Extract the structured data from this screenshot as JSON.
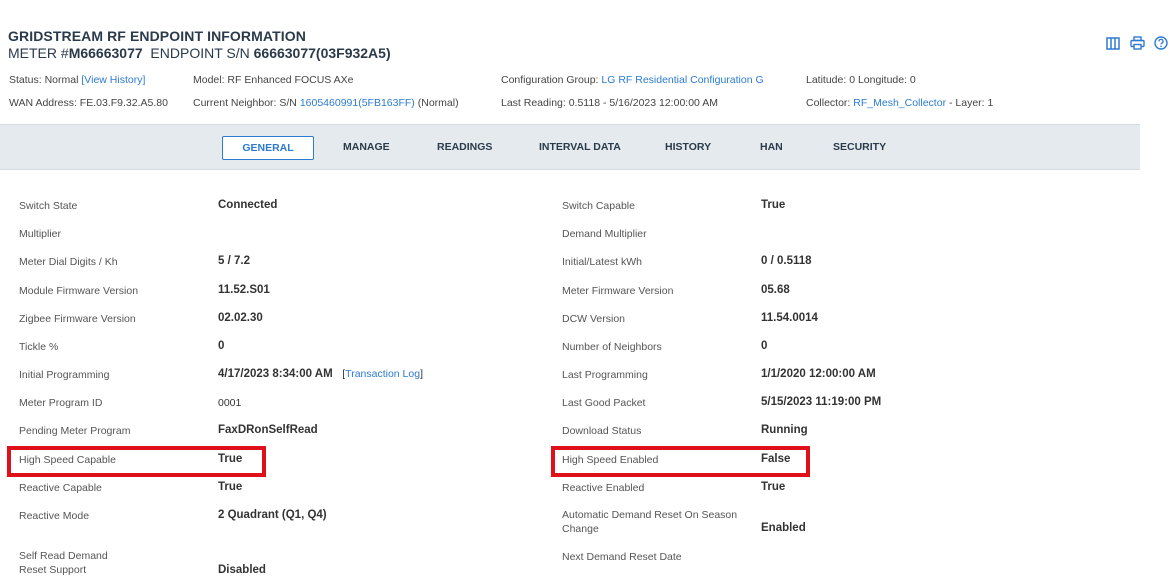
{
  "header": {
    "title": "GRIDSTREAM RF ENDPOINT INFORMATION",
    "meter_prefix": "METER #",
    "meter_number": "M66663077",
    "endpoint_prefix": "ENDPOINT S/N",
    "endpoint_sn": "66663077(03F932A5)"
  },
  "icons": [
    "columns-icon",
    "print-icon",
    "help-icon"
  ],
  "info": {
    "status_label": "Status: Normal",
    "status_link": "[View History]",
    "wan": "WAN Address: FE.03.F9.32.A5.80",
    "model": "Model: RF Enhanced FOCUS AXe",
    "neighbor_prefix": "Current Neighbor: S/N",
    "neighbor_link": "1605460991(5FB163FF)",
    "neighbor_suffix": "(Normal)",
    "config_prefix": "Configuration Group:",
    "config_link": "LG RF Residential Configuration G",
    "last_reading": "Last Reading: 0.5118 - 5/16/2023 12:00:00 AM",
    "latlong": "Latitude: 0  Longitude: 0",
    "collector_prefix": "Collector:",
    "collector_link": "RF_Mesh_Collector",
    "collector_suffix": "- Layer: 1"
  },
  "tabs": [
    "GENERAL",
    "MANAGE",
    "READINGS",
    "INTERVAL DATA",
    "HISTORY",
    "HAN",
    "SECURITY"
  ],
  "left": [
    {
      "label": "Switch State",
      "value": "Connected"
    },
    {
      "label": "Multiplier",
      "value": ""
    },
    {
      "label": "Meter Dial Digits / Kh",
      "value": "5 / 7.2"
    },
    {
      "label": "Module Firmware Version",
      "value": "11.52.S01"
    },
    {
      "label": "Zigbee Firmware Version",
      "value": "02.02.30"
    },
    {
      "label": "Tickle %",
      "value": "0"
    },
    {
      "label": "Initial Programming",
      "value": "4/17/2023 8:34:00 AM",
      "extra_open": "[",
      "extra_link": "Transaction Log",
      "extra_close": "]"
    },
    {
      "label": "Meter Program ID",
      "value": "0001"
    },
    {
      "label": "Pending Meter Program",
      "value": "FaxDRonSelfRead"
    },
    {
      "label": "High Speed Capable",
      "value": "True"
    },
    {
      "label": "Reactive Capable",
      "value": "True"
    },
    {
      "label": "Reactive Mode",
      "value": "2 Quadrant (Q1, Q4)"
    },
    {
      "label_line1": "Self Read Demand",
      "label_line2": "Reset Support",
      "value": "Disabled"
    }
  ],
  "right": [
    {
      "label": "Switch Capable",
      "value": "True"
    },
    {
      "label": "Demand Multiplier",
      "value": ""
    },
    {
      "label": "Initial/Latest kWh",
      "value": "0 / 0.5118"
    },
    {
      "label": "Meter Firmware Version",
      "value": "05.68"
    },
    {
      "label": "DCW Version",
      "value": "11.54.0014"
    },
    {
      "label": "Number of Neighbors",
      "value": "0"
    },
    {
      "label": "Last Programming",
      "value": "1/1/2020 12:00:00 AM"
    },
    {
      "label": "Last Good Packet",
      "value": "5/15/2023 11:19:00 PM"
    },
    {
      "label": "Download Status",
      "value": "Running"
    },
    {
      "label": "High Speed Enabled",
      "value": "False"
    },
    {
      "label": "Reactive Enabled",
      "value": "True"
    },
    {
      "label_line1": "Automatic Demand Reset On Season",
      "label_line2": "Change",
      "value": "Enabled"
    },
    {
      "label": "Next Demand Reset Date",
      "value": ""
    }
  ],
  "colors": {
    "link": "#2d7bd1",
    "highlight": "#e0101a",
    "tabbar": "#e5eaee"
  }
}
